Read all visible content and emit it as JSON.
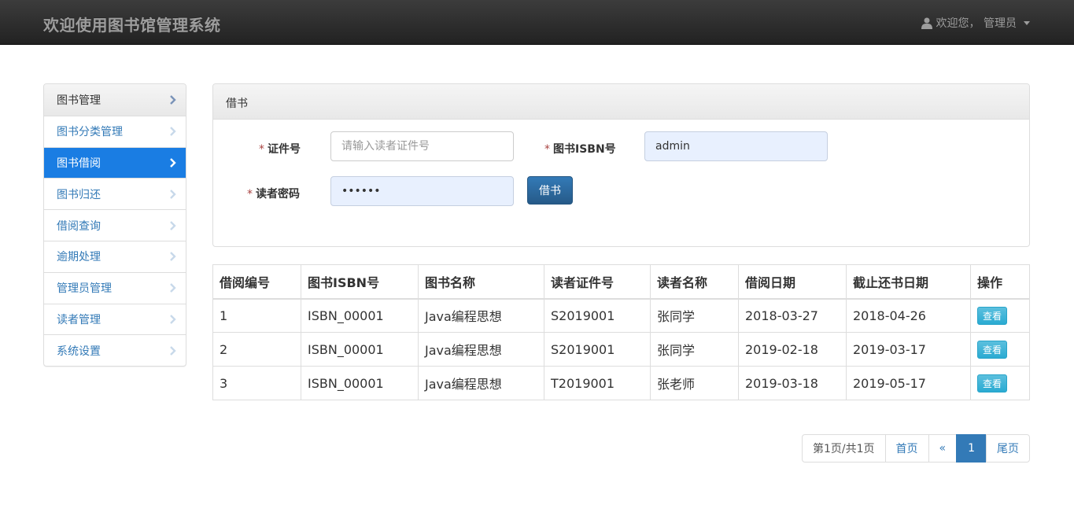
{
  "navbar": {
    "brand": "欢迎使用图书馆管理系统",
    "user_label": "欢迎您， 管理员"
  },
  "sidebar": {
    "items": [
      {
        "label": "图书管理"
      },
      {
        "label": "图书分类管理"
      },
      {
        "label": "图书借阅"
      },
      {
        "label": "图书归还"
      },
      {
        "label": "借阅查询"
      },
      {
        "label": "逾期处理"
      },
      {
        "label": "管理员管理"
      },
      {
        "label": "读者管理"
      },
      {
        "label": "系统设置"
      }
    ],
    "active_index": 2
  },
  "borrow_form": {
    "title": "借书",
    "required_mark": "*",
    "card_label": "证件号",
    "card_placeholder": "请输入读者证件号",
    "card_value": "",
    "isbn_label": "图书ISBN号",
    "isbn_value": "admin",
    "password_label": "读者密码",
    "password_value": "123456",
    "submit_label": "借书"
  },
  "table": {
    "headers": [
      "借阅编号",
      "图书ISBN号",
      "图书名称",
      "读者证件号",
      "读者名称",
      "借阅日期",
      "截止还书日期",
      "操作"
    ],
    "rows": [
      {
        "id": "1",
        "isbn": "ISBN_00001",
        "name": "Java编程思想",
        "card": "S2019001",
        "reader": "张同学",
        "borrow_date": "2018-03-27",
        "due_date": "2018-04-26",
        "action": "查看"
      },
      {
        "id": "2",
        "isbn": "ISBN_00001",
        "name": "Java编程思想",
        "card": "S2019001",
        "reader": "张同学",
        "borrow_date": "2019-02-18",
        "due_date": "2019-03-17",
        "action": "查看"
      },
      {
        "id": "3",
        "isbn": "ISBN_00001",
        "name": "Java编程思想",
        "card": "T2019001",
        "reader": "张老师",
        "borrow_date": "2019-03-18",
        "due_date": "2019-05-17",
        "action": "查看"
      }
    ]
  },
  "pagination": {
    "info": "第1页/共1页",
    "first": "首页",
    "prev": "«",
    "current": "1",
    "last": "尾页"
  },
  "colors": {
    "navbar_bg": "#222222",
    "active_item": "#1a7de3",
    "primary": "#337ab7",
    "info": "#5bc0de"
  }
}
